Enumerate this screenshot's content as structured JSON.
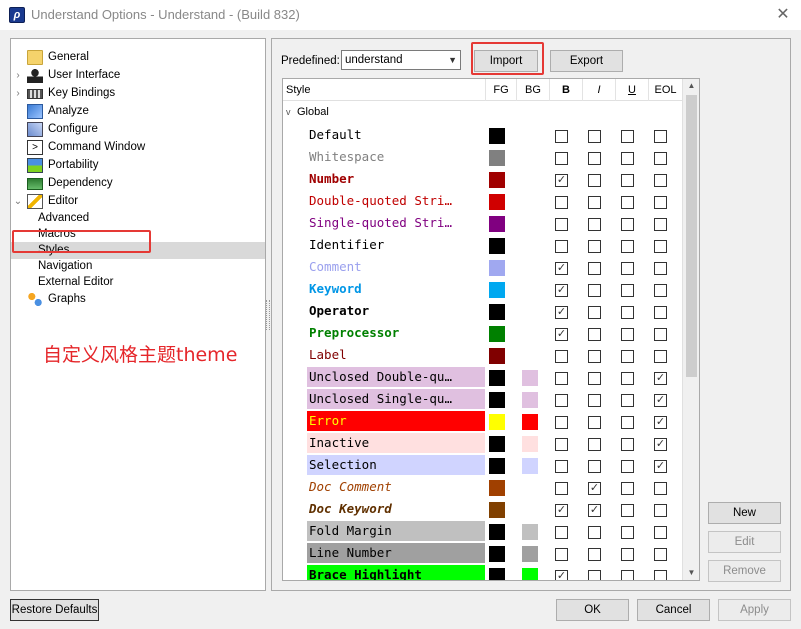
{
  "window": {
    "title": "Understand Options - Understand - (Build 832)",
    "close_glyph": "✕"
  },
  "tree": {
    "items": [
      {
        "label": "General",
        "icon": "folder-icon",
        "twisty": ""
      },
      {
        "label": "User Interface",
        "icon": "user-icon",
        "twisty": ">"
      },
      {
        "label": "Key Bindings",
        "icon": "keyboard-icon",
        "twisty": ">"
      },
      {
        "label": "Analyze",
        "icon": "analyze-icon",
        "twisty": ""
      },
      {
        "label": "Configure",
        "icon": "configure-icon",
        "twisty": ""
      },
      {
        "label": "Command Window",
        "icon": "terminal-icon",
        "twisty": ""
      },
      {
        "label": "Portability",
        "icon": "portability-icon",
        "twisty": ""
      },
      {
        "label": "Dependency",
        "icon": "dependency-icon",
        "twisty": ""
      },
      {
        "label": "Editor",
        "icon": "editor-icon",
        "twisty": "v"
      },
      {
        "label": "Advanced",
        "child": true
      },
      {
        "label": "Macros",
        "child": true
      },
      {
        "label": "Styles",
        "child": true,
        "selected": true
      },
      {
        "label": "Navigation",
        "child": true
      },
      {
        "label": "External Editor",
        "child": true
      },
      {
        "label": "Graphs",
        "icon": "graphs-icon",
        "twisty": ""
      }
    ]
  },
  "annotation": {
    "text": "自定义风格主题theme",
    "color": "#e5262a"
  },
  "toolbar": {
    "predefined_label": "Predefined:",
    "predefined_value": "understand",
    "import_label": "Import",
    "export_label": "Export"
  },
  "table": {
    "headers": {
      "style": "Style",
      "fg": "FG",
      "bg": "BG",
      "b": "B",
      "i": "I",
      "u": "U",
      "eol": "EOL"
    },
    "group": "Global",
    "rows": [
      {
        "name": "Default",
        "fg": "#000000",
        "bg": null,
        "color": "#000000",
        "highlight": null,
        "bold": false,
        "italic": false,
        "B": false,
        "I": false,
        "U": false,
        "EOL": false
      },
      {
        "name": "Whitespace",
        "fg": "#808080",
        "bg": null,
        "color": "#808080",
        "highlight": null,
        "bold": false,
        "italic": false,
        "B": false,
        "I": false,
        "U": false,
        "EOL": false
      },
      {
        "name": "Number",
        "fg": "#a00000",
        "bg": null,
        "color": "#a00000",
        "highlight": null,
        "bold": true,
        "italic": false,
        "B": true,
        "I": false,
        "U": false,
        "EOL": false
      },
      {
        "name": "Double-quoted Stri…",
        "fg": "#d00000",
        "bg": null,
        "color": "#c00000",
        "highlight": null,
        "bold": false,
        "italic": false,
        "B": false,
        "I": false,
        "U": false,
        "EOL": false
      },
      {
        "name": "Single-quoted Stri…",
        "fg": "#800080",
        "bg": null,
        "color": "#800080",
        "highlight": null,
        "bold": false,
        "italic": false,
        "B": false,
        "I": false,
        "U": false,
        "EOL": false
      },
      {
        "name": "Identifier",
        "fg": "#000000",
        "bg": null,
        "color": "#000000",
        "highlight": null,
        "bold": false,
        "italic": false,
        "B": false,
        "I": false,
        "U": false,
        "EOL": false
      },
      {
        "name": "Comment",
        "fg": "#a0a8f0",
        "bg": null,
        "color": "#9aa0ee",
        "highlight": null,
        "bold": false,
        "italic": false,
        "B": true,
        "I": false,
        "U": false,
        "EOL": false
      },
      {
        "name": "Keyword",
        "fg": "#00a8f0",
        "bg": null,
        "color": "#0096e6",
        "highlight": null,
        "bold": true,
        "italic": false,
        "B": true,
        "I": false,
        "U": false,
        "EOL": false
      },
      {
        "name": "Operator",
        "fg": "#000000",
        "bg": null,
        "color": "#000000",
        "highlight": null,
        "bold": true,
        "italic": false,
        "B": true,
        "I": false,
        "U": false,
        "EOL": false
      },
      {
        "name": "Preprocessor",
        "fg": "#008000",
        "bg": null,
        "color": "#008000",
        "highlight": null,
        "bold": true,
        "italic": false,
        "B": true,
        "I": false,
        "U": false,
        "EOL": false
      },
      {
        "name": "Label",
        "fg": "#800000",
        "bg": null,
        "color": "#800000",
        "highlight": null,
        "bold": false,
        "italic": false,
        "B": false,
        "I": false,
        "U": false,
        "EOL": false
      },
      {
        "name": "Unclosed Double-qu…",
        "fg": "#000000",
        "bg": "#e0c0e0",
        "color": "#000000",
        "highlight": "#e0c0e0",
        "bold": false,
        "italic": false,
        "B": false,
        "I": false,
        "U": false,
        "EOL": true
      },
      {
        "name": "Unclosed Single-qu…",
        "fg": "#000000",
        "bg": "#e0c0e0",
        "color": "#000000",
        "highlight": "#e0c0e0",
        "bold": false,
        "italic": false,
        "B": false,
        "I": false,
        "U": false,
        "EOL": true
      },
      {
        "name": "Error",
        "fg": "#ffff00",
        "bg": "#ff0000",
        "color": "#ffff00",
        "highlight": "#ff0000",
        "bold": false,
        "italic": false,
        "B": false,
        "I": false,
        "U": false,
        "EOL": true
      },
      {
        "name": "Inactive",
        "fg": "#000000",
        "bg": "#ffe0e0",
        "color": "#000000",
        "highlight": "#ffe0e0",
        "bold": false,
        "italic": false,
        "B": false,
        "I": false,
        "U": false,
        "EOL": true
      },
      {
        "name": "Selection",
        "fg": "#000000",
        "bg": "#d0d4ff",
        "color": "#000000",
        "highlight": "#d0d4ff",
        "bold": false,
        "italic": false,
        "B": false,
        "I": false,
        "U": false,
        "EOL": true
      },
      {
        "name": "Doc Comment",
        "fg": "#a04000",
        "bg": null,
        "color": "#a04000",
        "highlight": null,
        "bold": false,
        "italic": true,
        "B": false,
        "I": true,
        "U": false,
        "EOL": false
      },
      {
        "name": "Doc Keyword",
        "fg": "#804000",
        "bg": null,
        "color": "#603000",
        "highlight": null,
        "bold": true,
        "italic": true,
        "B": true,
        "I": true,
        "U": false,
        "EOL": false
      },
      {
        "name": "Fold Margin",
        "fg": "#000000",
        "bg": "#c0c0c0",
        "color": "#000000",
        "highlight": "#c0c0c0",
        "bold": false,
        "italic": false,
        "B": false,
        "I": false,
        "U": false,
        "EOL": false
      },
      {
        "name": "Line Number",
        "fg": "#000000",
        "bg": "#a0a0a0",
        "color": "#000000",
        "highlight": "#a0a0a0",
        "bold": false,
        "italic": false,
        "B": false,
        "I": false,
        "U": false,
        "EOL": false
      },
      {
        "name": "Brace Highlight",
        "fg": "#000000",
        "bg": "#00ff00",
        "color": "#000000",
        "highlight": "#00ff00",
        "bold": true,
        "italic": false,
        "B": true,
        "I": false,
        "U": false,
        "EOL": false
      }
    ]
  },
  "side_buttons": {
    "new_label": "New",
    "edit_label": "Edit",
    "remove_label": "Remove"
  },
  "footer": {
    "restore_label": "Restore Defaults",
    "ok_label": "OK",
    "cancel_label": "Cancel",
    "apply_label": "Apply"
  }
}
